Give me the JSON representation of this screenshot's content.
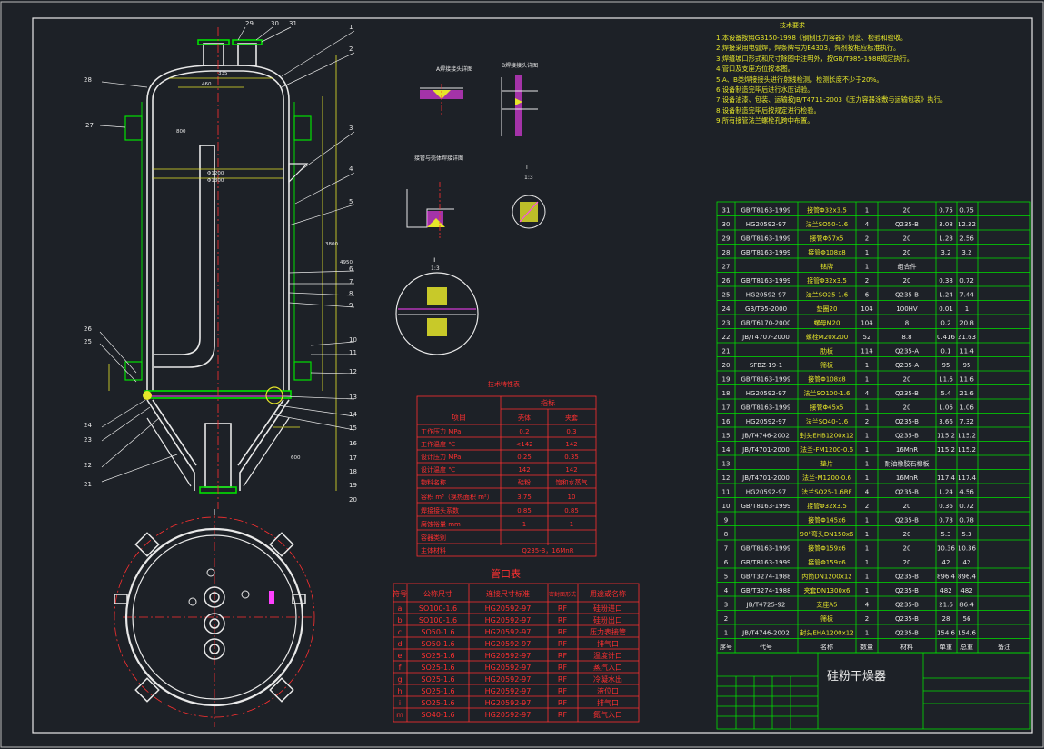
{
  "title_block": {
    "drawing_title": "硅粉干燥器"
  },
  "tech_requirements": {
    "title": "技术要求",
    "items": [
      "1.本设备按照GB150-1998《钢制压力容器》制造、检验和验收。",
      "2.焊接采用电弧焊，焊条牌号为E4303，焊剂按相应标准执行。",
      "3.焊缝坡口形式和尺寸除图中注明外，按GB/T985-1988规定执行。",
      "4.管口及支座方位按本图。",
      "5.A、B类焊接接头进行射线检测，检测长度不少于20%。",
      "6.设备制造完毕后进行水压试验。",
      "7.设备油漆、包装、运输按JB/T4711-2003《压力容器涂敷与运输包装》执行。",
      "8.设备制造完毕后按规定进行检验。",
      "9.所有接管法兰螺栓孔跨中布置。"
    ]
  },
  "design_data": {
    "title": "技术特性表",
    "group_header": "指标",
    "header": [
      "项目",
      "壳体",
      "夹套"
    ],
    "rows": [
      [
        "工作压力 MPa",
        "0.2",
        "0.3"
      ],
      [
        "工作温度 ℃",
        "<142",
        "142"
      ],
      [
        "设计压力 MPa",
        "0.25",
        "0.35"
      ],
      [
        "设计温度 ℃",
        "142",
        "142"
      ],
      [
        "物料名称",
        "硅粉",
        "饱和水蒸气"
      ],
      [
        "容积 m³（换热面积 m²）",
        "3.75",
        "10"
      ],
      [
        "焊接接头系数",
        "0.85",
        "0.85"
      ],
      [
        "腐蚀裕量 mm",
        "1",
        "1"
      ],
      [
        "容器类别",
        "",
        ""
      ],
      [
        "主体材料",
        "Q235-B，16MnR",
        ""
      ]
    ]
  },
  "nozzle_table": {
    "title": "管口表",
    "header": [
      "符号",
      "公称尺寸",
      "连接尺寸标准",
      "密封面形式",
      "用途或名称"
    ],
    "rows": [
      [
        "a",
        "SO100-1.6",
        "HG20592-97",
        "RF",
        "硅粉进口"
      ],
      [
        "b",
        "SO100-1.6",
        "HG20592-97",
        "RF",
        "硅粉出口"
      ],
      [
        "c",
        "SO50-1.6",
        "HG20592-97",
        "RF",
        "压力表接管"
      ],
      [
        "d",
        "SO50-1.6",
        "HG20592-97",
        "RF",
        "排气口"
      ],
      [
        "e",
        "SO25-1.6",
        "HG20592-97",
        "RF",
        "温度计口"
      ],
      [
        "f",
        "SO25-1.6",
        "HG20592-97",
        "RF",
        "蒸汽入口"
      ],
      [
        "g",
        "SO25-1.6",
        "HG20592-97",
        "RF",
        "冷凝水出"
      ],
      [
        "h",
        "SO25-1.6",
        "HG20592-97",
        "RF",
        "液位口"
      ],
      [
        "i",
        "SO25-1.6",
        "HG20592-97",
        "RF",
        "排气口"
      ],
      [
        "m",
        "SO40-1.6",
        "HG20592-97",
        "RF",
        "氮气入口"
      ]
    ]
  },
  "parts_list": {
    "header": [
      "序号",
      "代号",
      "名称",
      "数量",
      "材料",
      "单重",
      "总重",
      "备注"
    ],
    "rows": [
      [
        "31",
        "GB/T8163-1999",
        "接管Φ32x3.5",
        "1",
        "20",
        "0.75",
        "0.75",
        ""
      ],
      [
        "30",
        "HG20592-97",
        "法兰SO50-1.6",
        "4",
        "Q235-B",
        "3.08",
        "12.32",
        ""
      ],
      [
        "29",
        "GB/T8163-1999",
        "接管Φ57x5",
        "2",
        "20",
        "1.28",
        "2.56",
        ""
      ],
      [
        "28",
        "GB/T8163-1999",
        "接管Φ108x8",
        "1",
        "20",
        "3.2",
        "3.2",
        ""
      ],
      [
        "27",
        "",
        "铭牌",
        "1",
        "组合件",
        "",
        "",
        ""
      ],
      [
        "26",
        "GB/T8163-1999",
        "接管Φ32x3.5",
        "2",
        "20",
        "0.38",
        "0.72",
        ""
      ],
      [
        "25",
        "HG20592-97",
        "法兰SO25-1.6",
        "6",
        "Q235-B",
        "1.24",
        "7.44",
        ""
      ],
      [
        "24",
        "GB/T95-2000",
        "垫圈20",
        "104",
        "100HV",
        "0.01",
        "1",
        ""
      ],
      [
        "23",
        "GB/T6170-2000",
        "螺母M20",
        "104",
        "8",
        "0.2",
        "20.8",
        ""
      ],
      [
        "22",
        "JB/T4707-2000",
        "螺栓M20x200",
        "52",
        "8.8",
        "0.416",
        "21.63",
        ""
      ],
      [
        "21",
        "",
        "肋板",
        "114",
        "Q235-A",
        "0.1",
        "11.4",
        ""
      ],
      [
        "20",
        "SFBZ-19-1",
        "筛板",
        "1",
        "Q235-A",
        "95",
        "95",
        ""
      ],
      [
        "19",
        "GB/T8163-1999",
        "接管Φ108x8",
        "1",
        "20",
        "11.6",
        "11.6",
        ""
      ],
      [
        "18",
        "HG20592-97",
        "法兰SO100-1.6",
        "4",
        "Q235-B",
        "5.4",
        "21.6",
        ""
      ],
      [
        "17",
        "GB/T8163-1999",
        "接管Φ45x5",
        "1",
        "20",
        "1.06",
        "1.06",
        ""
      ],
      [
        "16",
        "HG20592-97",
        "法兰SO40-1.6",
        "2",
        "Q235-B",
        "3.66",
        "7.32",
        ""
      ],
      [
        "15",
        "JB/T4746-2002",
        "封头EHB1200x12",
        "1",
        "Q235-B",
        "115.2",
        "115.2",
        ""
      ],
      [
        "14",
        "JB/T4701-2000",
        "法兰-FM1200-0.6",
        "1",
        "16MnR",
        "115.2",
        "115.2",
        ""
      ],
      [
        "13",
        "",
        "垫片",
        "1",
        "耐油橡胶石棉板",
        "",
        "",
        ""
      ],
      [
        "12",
        "JB/T4701-2000",
        "法兰-M1200-0.6",
        "1",
        "16MnR",
        "117.4",
        "117.4",
        ""
      ],
      [
        "11",
        "HG20592-97",
        "法兰SO25-1.6RF",
        "4",
        "Q235-B",
        "1.24",
        "4.56",
        ""
      ],
      [
        "10",
        "GB/T8163-1999",
        "接管Φ32x3.5",
        "2",
        "20",
        "0.36",
        "0.72",
        ""
      ],
      [
        "9",
        "",
        "接管Φ145x6",
        "1",
        "Q235-B",
        "0.78",
        "0.78",
        ""
      ],
      [
        "8",
        "",
        "90°弯头DN150x6",
        "1",
        "20",
        "5.3",
        "5.3",
        ""
      ],
      [
        "7",
        "GB/T8163-1999",
        "接管Φ159x6",
        "1",
        "20",
        "10.36",
        "10.36",
        ""
      ],
      [
        "6",
        "GB/T8163-1999",
        "接管Φ159x6",
        "1",
        "20",
        "42",
        "42",
        ""
      ],
      [
        "5",
        "GB/T3274-1988",
        "内筒DN1200x12",
        "1",
        "Q235-B",
        "896.4",
        "896.4",
        ""
      ],
      [
        "4",
        "GB/T3274-1988",
        "夹套DN1300x6",
        "1",
        "Q235-B",
        "482",
        "482",
        ""
      ],
      [
        "3",
        "JB/T4725-92",
        "支座A5",
        "4",
        "Q235-B",
        "21.6",
        "86.4",
        ""
      ],
      [
        "2",
        "",
        "筛板",
        "2",
        "Q235-B",
        "28",
        "56",
        ""
      ],
      [
        "1",
        "JB/T4746-2002",
        "封头EHA1200x12",
        "1",
        "Q235-B",
        "154.6",
        "154.6",
        ""
      ]
    ]
  },
  "section_labels": {
    "weld_a": "A焊接接头详图",
    "weld_b": "B焊接接头详图",
    "weld_c": "接管与壳体焊接详图",
    "detail_i": "I",
    "detail_ii": "II",
    "scale_13": "1:3"
  },
  "diagram_labels": {
    "top_callouts": [
      "29",
      "30",
      "31"
    ],
    "right_callouts": [
      "1",
      "2",
      "3",
      "4",
      "5",
      "6",
      "7",
      "8",
      "9",
      "10",
      "11",
      "12",
      "13",
      "14",
      "15",
      "16",
      "17",
      "18",
      "19",
      "20"
    ],
    "left_callouts": [
      "28",
      "27",
      "26",
      "25",
      "24",
      "23",
      "22",
      "21"
    ],
    "dims": [
      "Φ1200",
      "Φ1300",
      "3800",
      "4950",
      "800",
      "460",
      "335",
      "600"
    ]
  },
  "colors": {
    "bg": "#1d2127",
    "line_white": "#e8e8e8",
    "green": "#00e000",
    "red": "#ff3030",
    "yellow": "#e6e62a",
    "magenta": "#ff40ff"
  }
}
